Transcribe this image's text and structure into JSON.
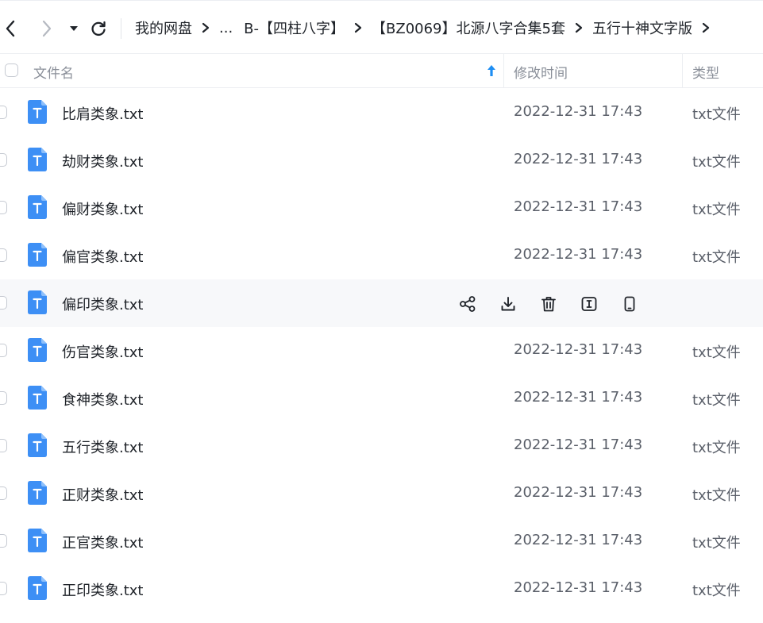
{
  "nav": {
    "back_icon": "chevron-left-icon",
    "forward_icon": "chevron-right-icon",
    "dropdown_icon": "caret-down-icon",
    "refresh_icon": "refresh-icon"
  },
  "breadcrumbs": [
    "我的网盘",
    "...",
    "B-【四柱八字】",
    "【BZ0069】北源八字合集5套",
    "五行十神文字版"
  ],
  "table": {
    "col_name": "文件名",
    "col_time": "修改时间",
    "col_type": "类型",
    "sort_icon": "sort-ascending-arrow-icon"
  },
  "files": [
    {
      "name": "比肩类象.txt",
      "time": "2022-12-31 17:43",
      "type": "txt文件"
    },
    {
      "name": "劫财类象.txt",
      "time": "2022-12-31 17:43",
      "type": "txt文件"
    },
    {
      "name": "偏财类象.txt",
      "time": "2022-12-31 17:43",
      "type": "txt文件"
    },
    {
      "name": "偏官类象.txt",
      "time": "2022-12-31 17:43",
      "type": "txt文件"
    },
    {
      "name": "偏印类象.txt",
      "time": "",
      "type": "",
      "hovered": true
    },
    {
      "name": "伤官类象.txt",
      "time": "2022-12-31 17:43",
      "type": "txt文件"
    },
    {
      "name": "食神类象.txt",
      "time": "2022-12-31 17:43",
      "type": "txt文件"
    },
    {
      "name": "五行类象.txt",
      "time": "2022-12-31 17:43",
      "type": "txt文件"
    },
    {
      "name": "正财类象.txt",
      "time": "2022-12-31 17:43",
      "type": "txt文件"
    },
    {
      "name": "正官类象.txt",
      "time": "2022-12-31 17:43",
      "type": "txt文件"
    },
    {
      "name": "正印类象.txt",
      "time": "2022-12-31 17:43",
      "type": "txt文件"
    }
  ],
  "row_actions": [
    "share-icon",
    "download-icon",
    "trash-icon",
    "rename-icon",
    "phone-icon"
  ],
  "colors": {
    "accent": "#1e8ef3",
    "file_icon": "#3d8ff5",
    "hover_row": "#f7f8fa"
  }
}
